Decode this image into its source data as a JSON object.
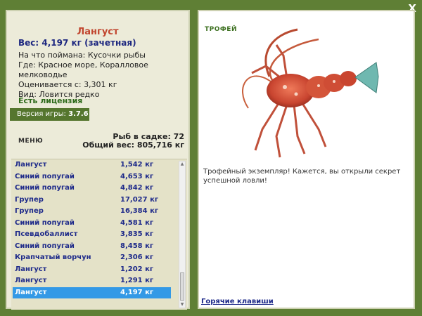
{
  "window": {
    "close_label": "X"
  },
  "catch": {
    "title": "Лангуст",
    "weight": "Вес: 4,197 кг (зачетная)",
    "bait": "На что поймана: Кусочки рыбы",
    "location": "Где: Красное море, Коралловое мелководье",
    "value": "Оценивается с: 3,301 кг",
    "rarity": "Вид: Ловится редко"
  },
  "license": "Есть лицензия",
  "version": {
    "label": "Версия игры:",
    "value": "3.7.6"
  },
  "menu_label": "МЕНЮ",
  "stats": {
    "fish_in_cage": "Рыб в садке: 72",
    "total_weight": "Общий вес: 805,716 кг"
  },
  "catch_list": [
    {
      "name": "Лангуст",
      "weight": "1,542 кг"
    },
    {
      "name": "Синий попугай",
      "weight": "4,653 кг"
    },
    {
      "name": "Синий попугай",
      "weight": "4,842 кг"
    },
    {
      "name": "Групер",
      "weight": "17,027 кг"
    },
    {
      "name": "Групер",
      "weight": "16,384 кг"
    },
    {
      "name": "Синий попугай",
      "weight": "4,581 кг"
    },
    {
      "name": "Псевдобаллист",
      "weight": "3,835 кг"
    },
    {
      "name": "Синий попугай",
      "weight": "8,458 кг"
    },
    {
      "name": "Крапчатый ворчун",
      "weight": "2,306 кг"
    },
    {
      "name": "Лангуст",
      "weight": "1,202 кг"
    },
    {
      "name": "Лангуст",
      "weight": "1,291 кг"
    },
    {
      "name": "Лангуст",
      "weight": "4,197 кг"
    }
  ],
  "selected_index": 11,
  "trophy": {
    "label": "ТРОФЕЙ",
    "text": "Трофейный экземпляр! Кажется, вы открыли секрет успешной ловли!"
  },
  "hotkeys_label": "Горячие клавиши",
  "colors": {
    "frame_green": "#5f7f35",
    "panel_bg": "#ecebd9",
    "title_red": "#c1452e",
    "list_text_blue": "#1e2a8a",
    "selection_blue": "#3399e6"
  }
}
